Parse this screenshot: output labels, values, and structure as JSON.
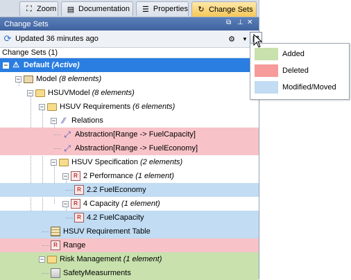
{
  "tabs": [
    {
      "label": "Zoom",
      "icon": "zoom-icon"
    },
    {
      "label": "Documentation",
      "icon": "documentation-icon"
    },
    {
      "label": "Properties",
      "icon": "properties-icon"
    },
    {
      "label": "Change Sets",
      "icon": "change-sets-icon"
    }
  ],
  "panel": {
    "title": "Change Sets",
    "updated_text": "Updated 36 minutes ago",
    "section_label": "Change Sets (1)"
  },
  "tree": [
    {
      "label": "Default",
      "note": "(Active)",
      "state": "selected",
      "icon": "warning-icon"
    },
    {
      "label": "Model",
      "note": "(8 elements)",
      "state": "none",
      "icon": "package-icon"
    },
    {
      "label": "HSUVModel",
      "note": "(8 elements)",
      "state": "none",
      "icon": "folder-icon"
    },
    {
      "label": "HSUV Requirements",
      "note": "(6 elements)",
      "state": "none",
      "icon": "folder-icon"
    },
    {
      "label": "Relations",
      "note": "",
      "state": "none",
      "icon": "relations-icon"
    },
    {
      "label": "Abstraction[Range -> FuelCapacity]",
      "note": "",
      "state": "deleted",
      "icon": "abstraction-icon"
    },
    {
      "label": "Abstraction[Range -> FuelEconomy]",
      "note": "",
      "state": "deleted",
      "icon": "abstraction-icon"
    },
    {
      "label": "HSUV Specification",
      "note": "(2 elements)",
      "state": "none",
      "icon": "folder-icon"
    },
    {
      "label": "2 Performance",
      "note": "(1 element)",
      "state": "none",
      "icon": "requirement-icon"
    },
    {
      "label": "2.2 FuelEconomy",
      "note": "",
      "state": "modified",
      "icon": "requirement-icon"
    },
    {
      "label": "4 Capacity",
      "note": "(1 element)",
      "state": "none",
      "icon": "requirement-icon"
    },
    {
      "label": "4.2 FuelCapacity",
      "note": "",
      "state": "modified",
      "icon": "requirement-icon"
    },
    {
      "label": "HSUV Requirement Table",
      "note": "",
      "state": "modified",
      "icon": "table-icon"
    },
    {
      "label": "Range",
      "note": "",
      "state": "deleted",
      "icon": "requirement-icon"
    },
    {
      "label": "Risk Management",
      "note": "(1 element)",
      "state": "added",
      "icon": "folder-icon"
    },
    {
      "label": "SafetyMeasurments",
      "note": "",
      "state": "added",
      "icon": "diagram-icon"
    }
  ],
  "legend": [
    {
      "label": "Added",
      "color": "#c8e1ad"
    },
    {
      "label": "Deleted",
      "color": "#f79a9a"
    },
    {
      "label": "Modified/Moved",
      "color": "#c1dcf3"
    }
  ],
  "colors": {
    "selected": "#2a7de1",
    "added": "#c8e1ad",
    "deleted": "#f8c3c8",
    "modified": "#c1dcf3",
    "titlebar": "#4a6fae"
  }
}
